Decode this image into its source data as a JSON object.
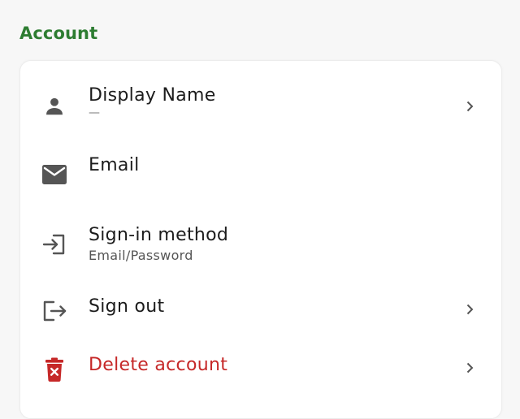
{
  "section": {
    "title": "Account"
  },
  "rows": [
    {
      "label": "Display Name",
      "sub": "—",
      "icon": "person-icon",
      "chevron": true
    },
    {
      "label": "Email",
      "sub": "",
      "icon": "mail-icon",
      "chevron": false
    },
    {
      "label": "Sign-in method",
      "sub": "Email/Password",
      "icon": "login-icon",
      "chevron": false
    },
    {
      "label": "Sign out",
      "sub": "",
      "icon": "logout-icon",
      "chevron": true
    },
    {
      "label": "Delete account",
      "sub": "",
      "icon": "trash-icon",
      "chevron": true
    }
  ],
  "colors": {
    "accent": "#2e7d32",
    "danger": "#c62828",
    "icon": "#555555"
  }
}
